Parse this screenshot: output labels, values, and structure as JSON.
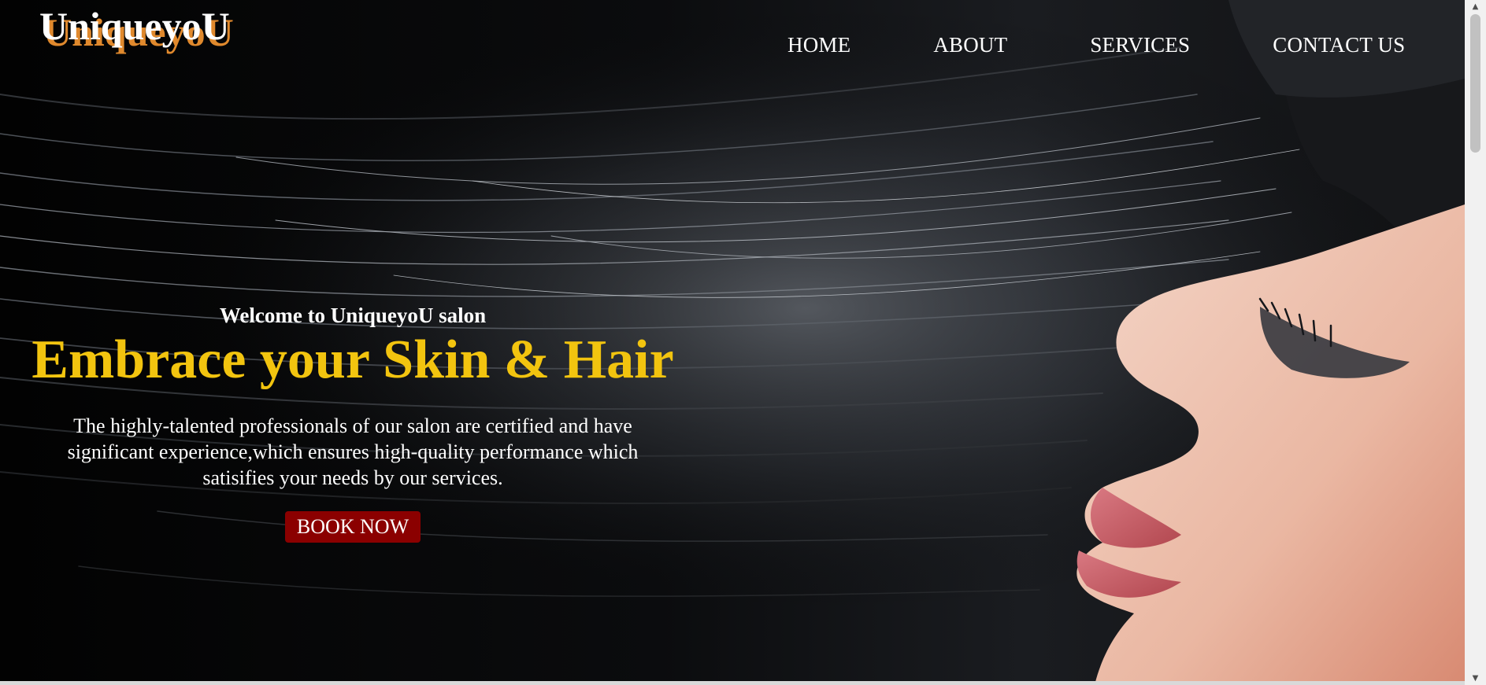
{
  "brand": {
    "logo_text": "UniqueyoU"
  },
  "nav": {
    "items": [
      {
        "label": "HOME"
      },
      {
        "label": "ABOUT"
      },
      {
        "label": "SERVICES"
      },
      {
        "label": "CONTACT US"
      }
    ]
  },
  "hero": {
    "welcome": "Welcome to UniqueyoU salon",
    "headline": "Embrace your Skin & Hair",
    "description": "The highly-talented professionals of our salon are certified and have significant experience,which ensures high-quality performance which satisifies your needs by our services.",
    "cta_label": "BOOK NOW",
    "image_subject": "woman with long black hair in profile"
  },
  "colors": {
    "accent_yellow": "#f2c40f",
    "logo_shadow": "#e0892d",
    "button_bg": "#8b0000"
  },
  "scrollbar": {
    "up_glyph": "▲",
    "down_glyph": "▼"
  }
}
